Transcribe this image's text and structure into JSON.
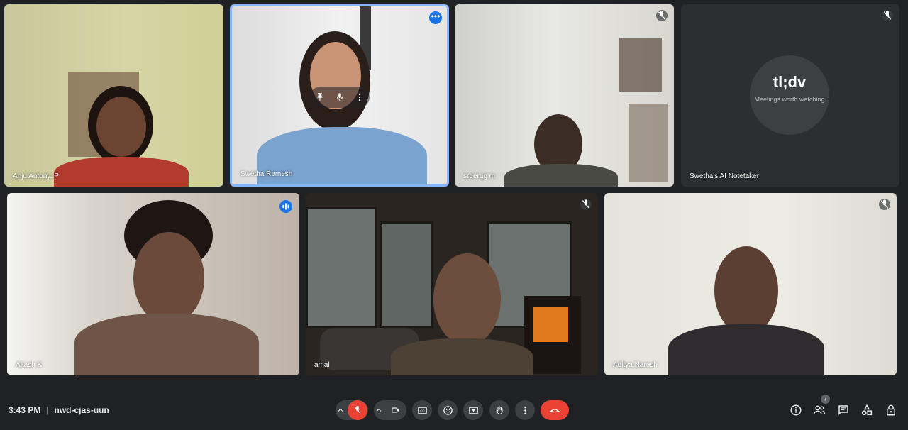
{
  "participants": [
    {
      "name": "Anju Antony. P"
    },
    {
      "name": "Swetha Ramesh"
    },
    {
      "name": "sreerag m"
    },
    {
      "name": "Swetha's AI Notetaker"
    },
    {
      "name": "Akash K"
    },
    {
      "name": "amal"
    },
    {
      "name": "Aditya Naresh"
    }
  ],
  "notetaker": {
    "logo": "tl;dv",
    "tagline": "Meetings worth watching"
  },
  "meeting": {
    "time": "3:43 PM",
    "separator": "|",
    "code": "nwd-cjas-uun"
  },
  "people_count": "7",
  "colors": {
    "background": "#202124",
    "accent": "#1a73e8",
    "end_call": "#ea4335",
    "control_bg": "#3c4043"
  },
  "icons": {
    "controls": [
      "chevron-up-icon",
      "mic-off-icon",
      "camera-icon",
      "captions-icon",
      "emoji-icon",
      "present-icon",
      "raise-hand-icon",
      "more-options-icon",
      "end-call-icon"
    ],
    "right": [
      "info-icon",
      "people-icon",
      "chat-icon",
      "activities-icon",
      "host-controls-icon"
    ]
  }
}
